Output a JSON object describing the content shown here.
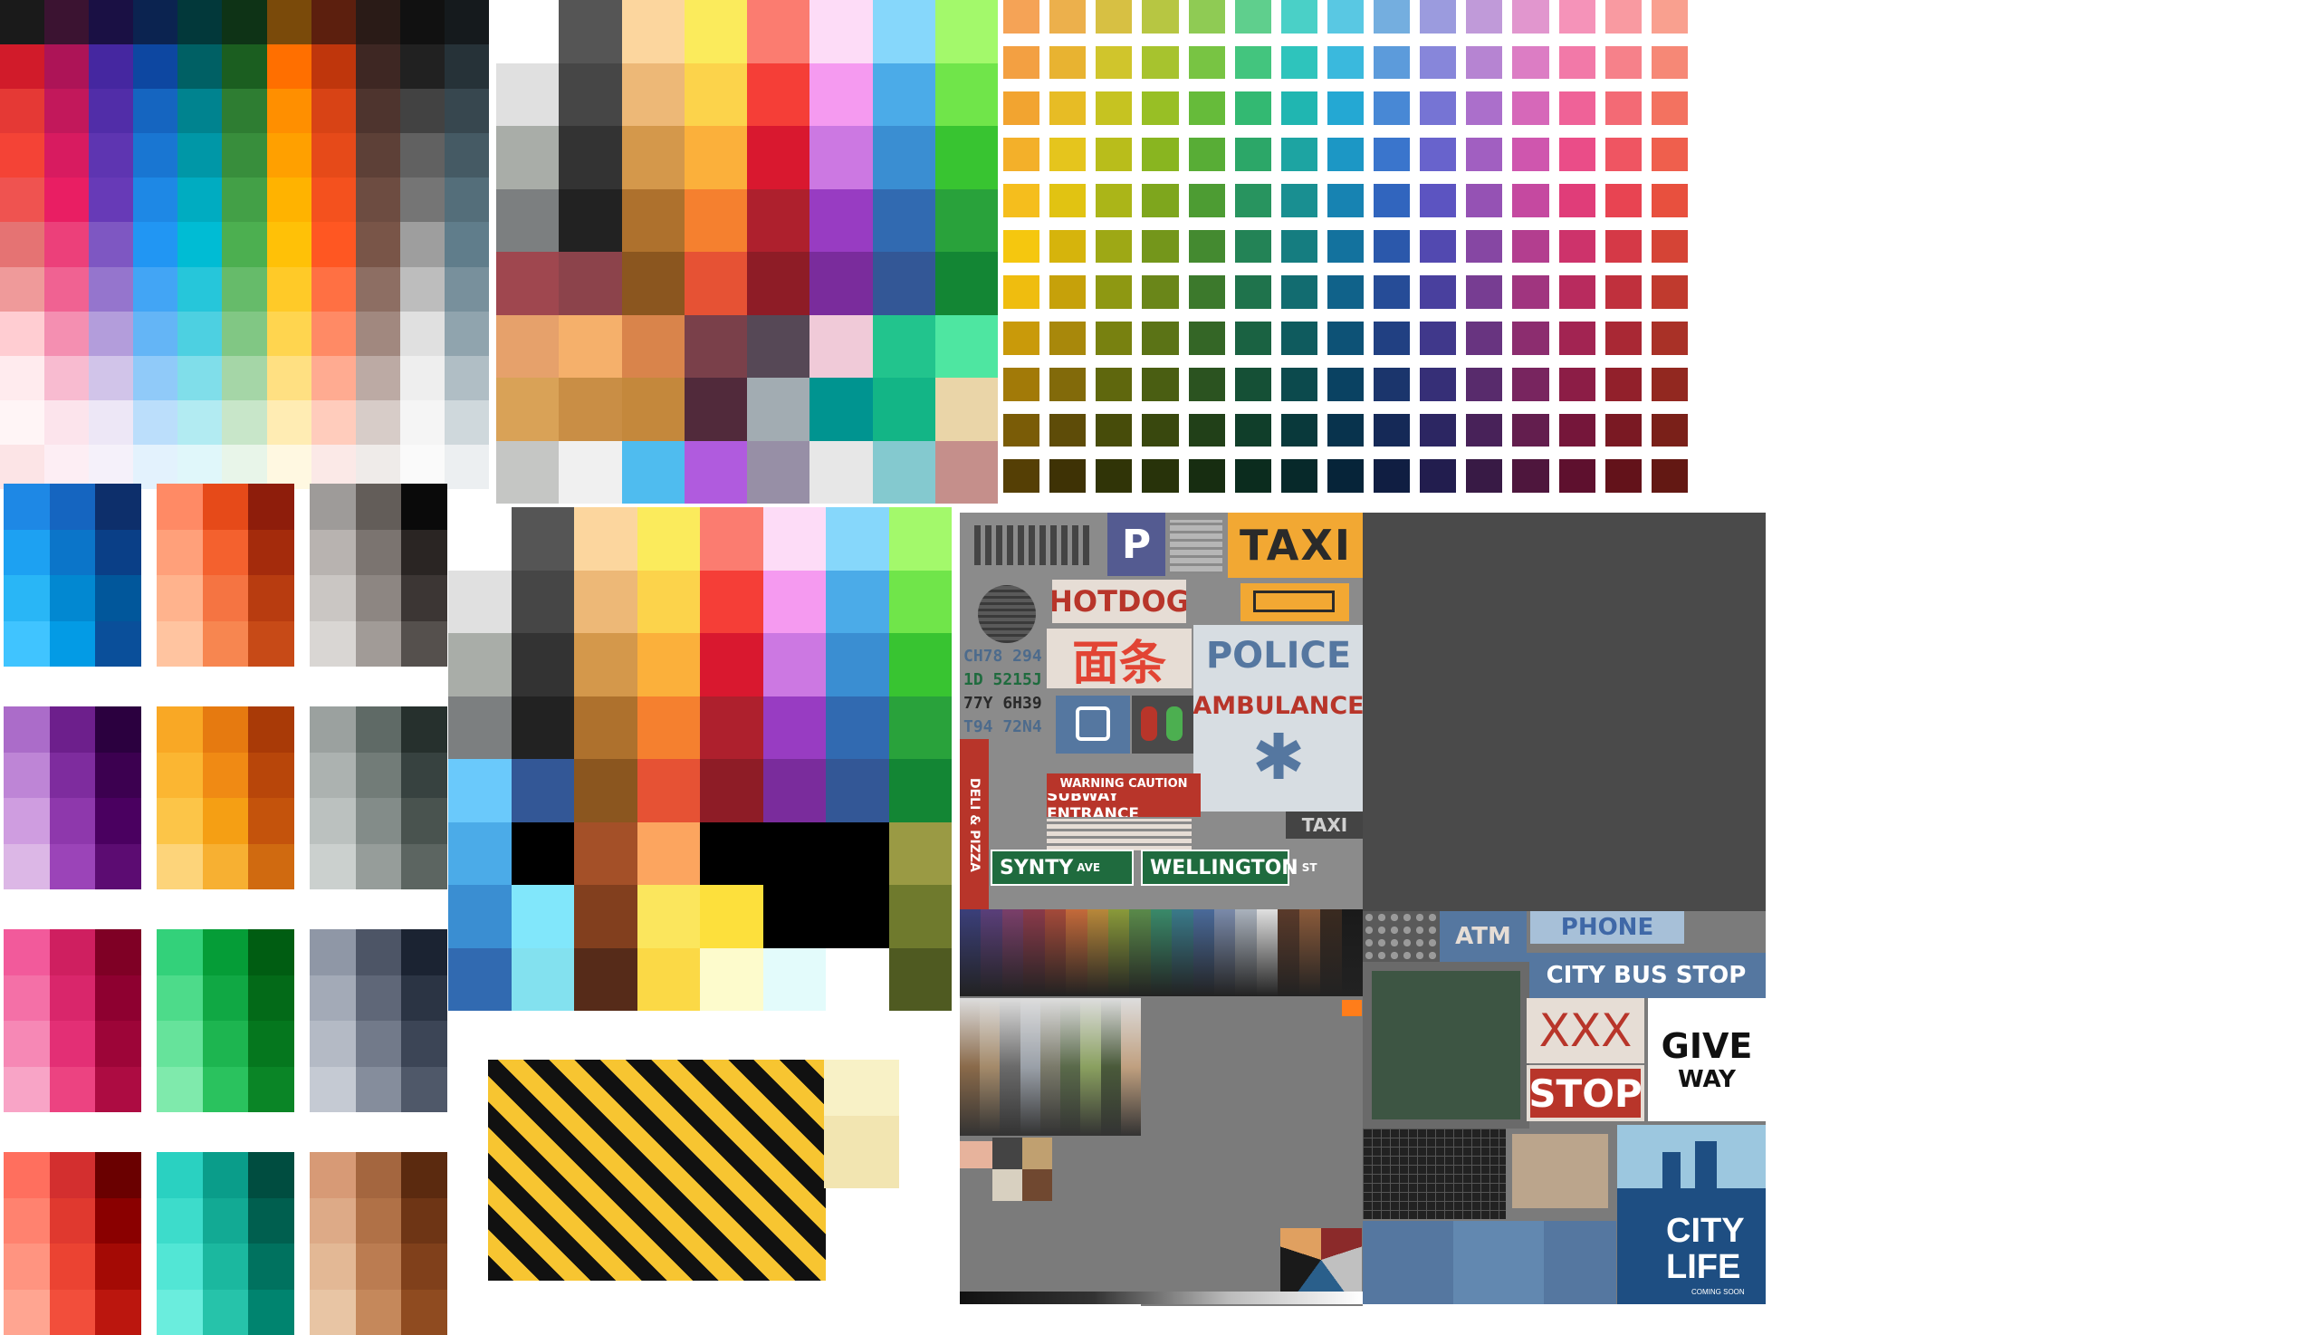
{
  "material_palette": {
    "columns": [
      [
        "#d11b2a",
        "#e53935",
        "#f44336",
        "#ef5350",
        "#e57373",
        "#ef9a9a",
        "#ffcdd2",
        "#ffebee",
        "#fff5f6",
        "#fce4e6"
      ],
      [
        "#ad1457",
        "#c2185b",
        "#d81b60",
        "#e91e63",
        "#ec407a",
        "#f06292",
        "#f48fb1",
        "#f8bbd0",
        "#fce4ec",
        "#fdeef4"
      ],
      [
        "#4527a0",
        "#512da8",
        "#5e35b1",
        "#673ab7",
        "#7e57c2",
        "#9575cd",
        "#b39ddb",
        "#d1c4e9",
        "#ede7f6",
        "#f5f1fa"
      ],
      [
        "#0d47a1",
        "#1565c0",
        "#1976d2",
        "#1e88e5",
        "#2196f3",
        "#42a5f5",
        "#64b5f6",
        "#90caf9",
        "#bbdefb",
        "#e3f2fd"
      ],
      [
        "#006064",
        "#00838f",
        "#0097a7",
        "#00acc1",
        "#00bcd4",
        "#26c6da",
        "#4dd0e1",
        "#80deea",
        "#b2ebf2",
        "#e0f7fa"
      ],
      [
        "#1b5e20",
        "#2e7d32",
        "#388e3c",
        "#43a047",
        "#4caf50",
        "#66bb6a",
        "#81c784",
        "#a5d6a7",
        "#c8e6c9",
        "#e8f5e9"
      ],
      [
        "#ff6f00",
        "#ff8f00",
        "#ffa000",
        "#ffb300",
        "#ffc107",
        "#ffca28",
        "#ffd54f",
        "#ffe082",
        "#ffecb3",
        "#fff8e1"
      ],
      [
        "#bf360c",
        "#d84315",
        "#e64a19",
        "#f4511e",
        "#ff5722",
        "#ff7043",
        "#ff8a65",
        "#ffab91",
        "#ffccbc",
        "#fbe9e7"
      ],
      [
        "#3e2723",
        "#4e342e",
        "#5d4037",
        "#6d4c41",
        "#795548",
        "#8d6e63",
        "#a1887f",
        "#bcaaa4",
        "#d7ccc8",
        "#efebe9"
      ],
      [
        "#212121",
        "#424242",
        "#616161",
        "#757575",
        "#9e9e9e",
        "#bdbdbd",
        "#e0e0e0",
        "#eeeeee",
        "#f5f5f5",
        "#fafafa"
      ],
      [
        "#263238",
        "#37474f",
        "#455a64",
        "#546e7a",
        "#607d8b",
        "#78909c",
        "#90a4ae",
        "#b0bec5",
        "#cfd8dc",
        "#eceff1"
      ]
    ],
    "top_row": [
      "#1a1a1a",
      "#3b1331",
      "#1a1044",
      "#0b2350",
      "#02383a",
      "#0e3316",
      "#7a4a0a",
      "#5c1f0e",
      "#2a1b17",
      "#111111",
      "#151a1d"
    ]
  },
  "pixel_palette_1": {
    "columns": [
      [
        "#ffffff",
        "#e0e0e0",
        "#a9ada8",
        "#7c7f80",
        "#9f474f",
        "#e6a16b",
        "#d9a257",
        "#c5c6c4"
      ],
      [
        "#555555",
        "#464646",
        "#333333",
        "#222222",
        "#8c434b",
        "#f5b06b",
        "#c98e45",
        "#f0f0f0"
      ],
      [
        "#fcd69e",
        "#edb877",
        "#d4984b",
        "#ae712d",
        "#8b561f",
        "#d9844b",
        "#c4883c",
        "#4fbcef"
      ],
      [
        "#fbeb5c",
        "#fcd34b",
        "#fbb03b",
        "#f5802f",
        "#e65234",
        "#7a404a",
        "#512a3b",
        "#b05bde"
      ],
      [
        "#fb7c70",
        "#f53e37",
        "#d9182f",
        "#ae202d",
        "#8e1c26",
        "#564856",
        "#a2acb2",
        "#978fa6"
      ],
      [
        "#fddcf7",
        "#f59af0",
        "#cc78e2",
        "#983cc2",
        "#7a2c9c",
        "#f0cad8",
        "#009490",
        "#e7e7e7"
      ],
      [
        "#86d7fb",
        "#4babe8",
        "#3a8ed2",
        "#316ab1",
        "#335796",
        "#22c48d",
        "#13b586",
        "#84c9cf"
      ],
      [
        "#a3f96b",
        "#70e54a",
        "#38c431",
        "#29a23b",
        "#138634",
        "#4ee6a1",
        "#ead5a8",
        "#c58f8b"
      ]
    ]
  },
  "rainbow_grid": {
    "columns": [
      [
        "#f5a356",
        "#f3a042",
        "#f2a430",
        "#f3b02a",
        "#f5be1d",
        "#f5c70f",
        "#efbd0f",
        "#c99a0a",
        "#a27a08",
        "#7a5c07",
        "#553f05"
      ],
      [
        "#ecb04c",
        "#e8b331",
        "#e7bc25",
        "#e5c51d",
        "#e1c312",
        "#d6b40c",
        "#c6a10a",
        "#a8880b",
        "#826a0a",
        "#5e4c08",
        "#3e3205"
      ],
      [
        "#d7c043",
        "#d0c52c",
        "#c6c321",
        "#b9bd1b",
        "#abb518",
        "#9ea815",
        "#8e9812",
        "#788110",
        "#5f670d",
        "#474c0a",
        "#303407"
      ],
      [
        "#b7c642",
        "#a7c32e",
        "#98bf25",
        "#89b520",
        "#7ea61d",
        "#74961b",
        "#6a8619",
        "#5b7316",
        "#4a5e12",
        "#39480e",
        "#28330a"
      ],
      [
        "#8fcb54",
        "#78c443",
        "#66bb3a",
        "#58ad36",
        "#4d9c33",
        "#448a30",
        "#3c792c",
        "#346626",
        "#2b5320",
        "#214018",
        "#172d11"
      ],
      [
        "#5fcf8d",
        "#43c57e",
        "#33b972",
        "#2ca768",
        "#28945f",
        "#238356",
        "#1f734c",
        "#1a6242",
        "#155036",
        "#103e2a",
        "#0b2c1e"
      ],
      [
        "#4ad0c7",
        "#2ec4bc",
        "#20b6b1",
        "#1da4a2",
        "#198f91",
        "#157d80",
        "#126c70",
        "#0f5b5e",
        "#0c4a4d",
        "#09393b",
        "#07292a"
      ],
      [
        "#59c8e3",
        "#3ab9dd",
        "#24a8d3",
        "#1c97c5",
        "#1783b2",
        "#13729e",
        "#10628a",
        "#0d5276",
        "#0a4262",
        "#08334d",
        "#062439"
      ],
      [
        "#74aedf",
        "#5c9bdb",
        "#4888d5",
        "#3a75cc",
        "#3165be",
        "#2b58ab",
        "#264c97",
        "#214082",
        "#1b356c",
        "#152957",
        "#101e42"
      ],
      [
        "#9b9bde",
        "#8786da",
        "#7674d4",
        "#6863cc",
        "#5c54c1",
        "#5249b0",
        "#49409e",
        "#40388b",
        "#362f77",
        "#2c2662",
        "#221d4e"
      ],
      [
        "#c09ad9",
        "#b684d2",
        "#ab6fcb",
        "#a15fc1",
        "#9552b4",
        "#8647a3",
        "#773d92",
        "#683480",
        "#582b6c",
        "#482259",
        "#381a45"
      ],
      [
        "#e196ce",
        "#dc7dc4",
        "#d668b9",
        "#cf56ae",
        "#c549a0",
        "#b33e8f",
        "#a0357f",
        "#8c2d6f",
        "#78255f",
        "#631e4e",
        "#4e163d"
      ],
      [
        "#f593b9",
        "#f279a8",
        "#ef6298",
        "#ea4d88",
        "#e03d79",
        "#cd336b",
        "#b82b5e",
        "#a22452",
        "#8c1d46",
        "#75163a",
        "#5e102e"
      ],
      [
        "#f99aa1",
        "#f6818a",
        "#f36a75",
        "#ef5562",
        "#e84452",
        "#d53947",
        "#c0303d",
        "#a92834",
        "#92202b",
        "#7a1923",
        "#63121a"
      ],
      [
        "#f9a08f",
        "#f68876",
        "#f37260",
        "#ef5f4d",
        "#e8503e",
        "#d54436",
        "#c03a2e",
        "#a93127",
        "#922820",
        "#7a2019",
        "#631813"
      ]
    ]
  },
  "small_palettes": [
    [
      "#1e88e5",
      "#1565c0",
      "#0d2f6b",
      "#1da1f2",
      "#0b75c9",
      "#0a3f87",
      "#29b6f6",
      "#0288d1",
      "#01579b",
      "#40c4ff",
      "#039be5",
      "#0a4f9a"
    ],
    [
      "#ff8a65",
      "#e64a19",
      "#8e1d0b",
      "#ffa07a",
      "#f4612e",
      "#a42b0c",
      "#ffb38d",
      "#f57442",
      "#b83c10",
      "#ffc4a0",
      "#f78650",
      "#c74a17"
    ],
    [
      "#9e9b99",
      "#635d59",
      "#0a0a0a",
      "#b8b3b0",
      "#7b7470",
      "#2a2523",
      "#cac6c3",
      "#8d8682",
      "#3c3634",
      "#d9d6d3",
      "#a19b97",
      "#55504d"
    ],
    [
      "#ab6cc9",
      "#6d1f8c",
      "#2b003f",
      "#be85d6",
      "#7e2c9e",
      "#3c0050",
      "#cf9de0",
      "#8e38ac",
      "#4a0060",
      "#dcb7e6",
      "#9b44b8",
      "#5c0c72"
    ],
    [
      "#f9a825",
      "#e67a10",
      "#a93a07",
      "#fbb632",
      "#f08a14",
      "#b8460a",
      "#fcc548",
      "#f59f14",
      "#c4530c",
      "#fdd47a",
      "#f7b032",
      "#d06a10"
    ],
    [
      "#9ba19f",
      "#5f6a66",
      "#26302d",
      "#acb2b0",
      "#727c78",
      "#374240",
      "#bbc1bf",
      "#838c89",
      "#49534f",
      "#cbd0ce",
      "#969d9a",
      "#5c6561"
    ],
    [
      "#f25a9b",
      "#cf1f60",
      "#7f0025",
      "#f470a7",
      "#d9266b",
      "#8e0030",
      "#f688b5",
      "#e32f75",
      "#9d0538",
      "#f8a4c6",
      "#ec4381",
      "#ad0c42"
    ],
    [
      "#33d17a",
      "#059d37",
      "#005d12",
      "#4ddb8a",
      "#10a844",
      "#036a18",
      "#66e39b",
      "#1db550",
      "#05771e",
      "#7feaac",
      "#2ac25e",
      "#0a8526"
    ],
    [
      "#8f97a6",
      "#4d5566",
      "#1b2332",
      "#a3aab7",
      "#5f6778",
      "#2b3444",
      "#b4bac5",
      "#727a8a",
      "#3c4556",
      "#c5cad3",
      "#858d9c",
      "#4f5869"
    ],
    [
      "#ff6f5e",
      "#d32f2f",
      "#6a0000",
      "#ff826f",
      "#e0392f",
      "#8a0000",
      "#ff9480",
      "#eb4332",
      "#a40a05",
      "#ffa591",
      "#f24e3b",
      "#bb160e"
    ],
    [
      "#2ad1c1",
      "#0a9d8a",
      "#004d40",
      "#3ddccb",
      "#12aa94",
      "#005f4f",
      "#52e6d5",
      "#1bb89f",
      "#00725f",
      "#6aeddd",
      "#26c3aa",
      "#00846f"
    ],
    [
      "#d79a76",
      "#a4663f",
      "#5b2a0f",
      "#ddaa87",
      "#b07147",
      "#6e3515",
      "#e3b895",
      "#bb7c51",
      "#80401b",
      "#e8c5a4",
      "#c5885b",
      "#8f4b20"
    ]
  ],
  "pixel_palette_2": {
    "columns": [
      [
        "#ffffff",
        "#e0e0e0",
        "#a9ada8",
        "#7c7f80",
        "#6ac9fb",
        "#4babe8",
        "#3a8ed2",
        "#316ab1"
      ],
      [
        "#555555",
        "#464646",
        "#333333",
        "#222222",
        "#335796",
        "#000000",
        "#81e7fb",
        "#83e1ef"
      ],
      [
        "#fcd69e",
        "#edb877",
        "#d4984b",
        "#ae712d",
        "#8b561f",
        "#a45028",
        "#823f1e",
        "#562b19"
      ],
      [
        "#fbeb5c",
        "#fcd34b",
        "#fbb03b",
        "#f5802f",
        "#e65234",
        "#fca55f",
        "#fbe65d",
        "#fbd946"
      ],
      [
        "#fb7c70",
        "#f53e37",
        "#d9182f",
        "#ae202d",
        "#8e1c26",
        "#000000",
        "#fde03c",
        "#fdfbcc"
      ],
      [
        "#fddcf7",
        "#f59af0",
        "#cc78e2",
        "#983cc2",
        "#7a2c9c",
        "#000000",
        "#000000",
        "#e3fbfb"
      ],
      [
        "#86d7fb",
        "#4babe8",
        "#3a8ed2",
        "#316ab1",
        "#335796",
        "#000000",
        "#000000",
        "#ffffff"
      ],
      [
        "#a3f96b",
        "#70e54a",
        "#38c431",
        "#29a23b",
        "#138634",
        "#9a9a44",
        "#6f7a2d",
        "#4f5a21"
      ]
    ]
  },
  "signs": {
    "parking": "P",
    "taxi_main": "TAXI",
    "hotdog": "HOTDOG",
    "noodles": "面条",
    "police": "POLICE",
    "ambulance": "AMBULANCE",
    "star_of_life": "✱",
    "plates": [
      "CH78 294",
      "1D 5215J",
      "77Y 6H39",
      "T94 72N4"
    ],
    "deli": "DELI & PIZZA",
    "warning": "WARNING CAUTION",
    "subway": "SUBWAY ENTRANCE",
    "taxi_small": "TAXI",
    "street1": "SYNTY",
    "street1_suffix": "AVE",
    "street2": "WELLINGTON",
    "street2_suffix": "ST",
    "atm": "ATM",
    "phone": "PHONE",
    "bus_stop": "CITY BUS STOP",
    "xxx": "XXX",
    "give": "GIVE",
    "way": "WAY",
    "stop": "STOP",
    "city": "CITY",
    "life": "LIFE",
    "coming_soon": "COMING SOON"
  },
  "accent_colors": {
    "sign_red": "#b8352a",
    "sign_blue": "#5577a0",
    "taxi_yellow": "#f2a833",
    "street_green": "#1f6b3e",
    "asphalt": "#4a4a4a",
    "hazard_yellow": "#f7c531"
  }
}
